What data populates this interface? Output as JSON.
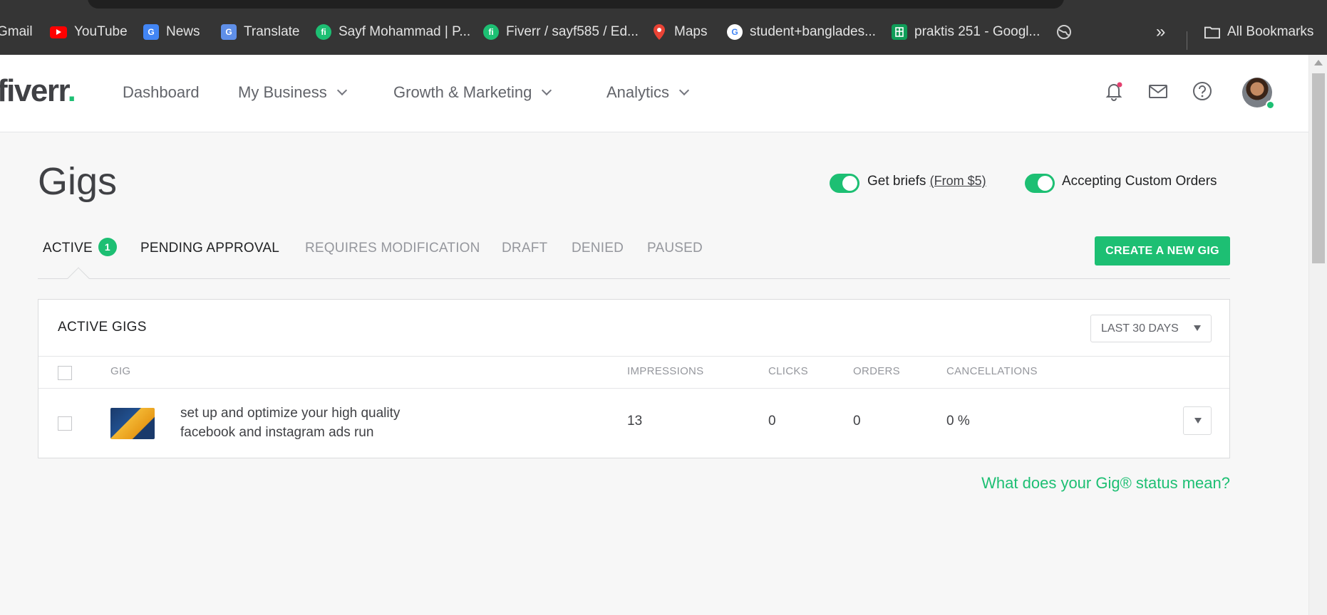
{
  "bookmarks": [
    {
      "label": "Gmail",
      "icon": "gmail-icon"
    },
    {
      "label": "YouTube",
      "icon": "youtube-icon"
    },
    {
      "label": "News",
      "icon": "google-news-icon"
    },
    {
      "label": "Translate",
      "icon": "google-translate-icon"
    },
    {
      "label": "Sayf Mohammad | P...",
      "icon": "fiverr-icon"
    },
    {
      "label": "Fiverr / sayf585 / Ed...",
      "icon": "fiverr-icon"
    },
    {
      "label": "Maps",
      "icon": "google-maps-icon"
    },
    {
      "label": "student+banglades...",
      "icon": "google-icon"
    },
    {
      "label": "praktis 251 - Googl...",
      "icon": "google-sheets-icon"
    }
  ],
  "bookmarks_more": "»",
  "all_bookmarks": "All Bookmarks",
  "header": {
    "logo": "fiverr",
    "logo_dot": ".",
    "nav": [
      "Dashboard",
      "My Business",
      "Growth & Marketing",
      "Analytics"
    ]
  },
  "page": {
    "title": "Gigs",
    "toggles": {
      "briefs_label": "Get briefs",
      "briefs_link": "(From $5)",
      "custom_label": "Accepting Custom Orders"
    },
    "tabs": {
      "active": "ACTIVE",
      "active_count": "1",
      "pending": "PENDING APPROVAL",
      "modification": "REQUIRES MODIFICATION",
      "draft": "DRAFT",
      "denied": "DENIED",
      "paused": "PAUSED"
    },
    "create_button": "CREATE A NEW GIG",
    "help_link": "What does your Gig® status mean?"
  },
  "table": {
    "title": "ACTIVE GIGS",
    "range": "LAST 30 DAYS",
    "headers": {
      "gig": "GIG",
      "impressions": "IMPRESSIONS",
      "clicks": "CLICKS",
      "orders": "ORDERS",
      "cancellations": "CANCELLATIONS"
    },
    "rows": [
      {
        "title": "set up and optimize your high quality facebook and instagram ads run",
        "impressions": "13",
        "clicks": "0",
        "orders": "0",
        "cancellations": "0 %"
      }
    ]
  },
  "colors": {
    "brand_green": "#1dbf73",
    "chrome_dark": "#353535",
    "text_dark": "#404145"
  }
}
